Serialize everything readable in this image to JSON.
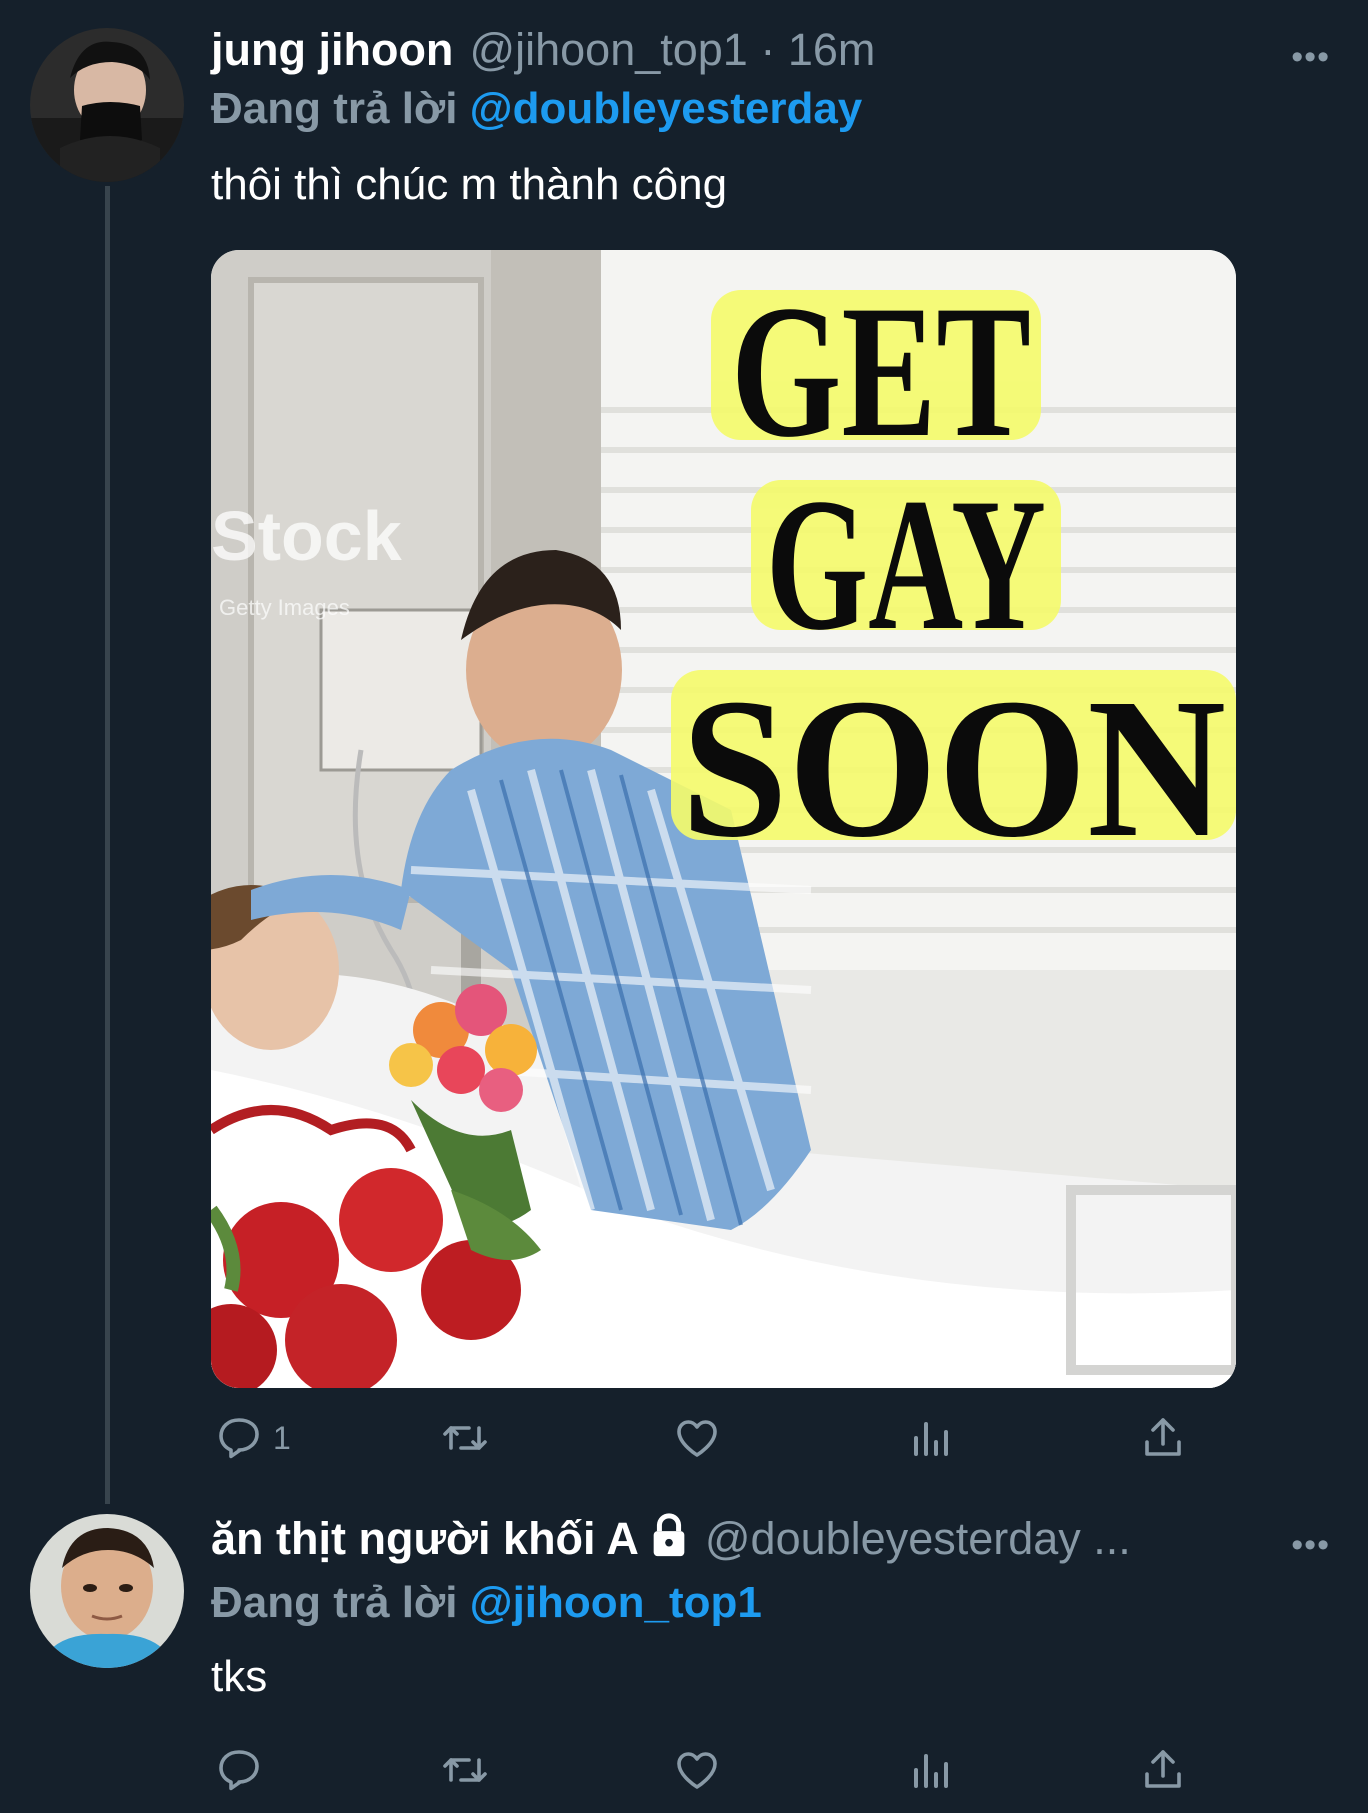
{
  "tweets": [
    {
      "name": "jung jihoon",
      "handle": "@jihoon_top1 · 16m",
      "reply_prefix": "Đang trả lời",
      "reply_mention": "@doubleyesterday",
      "text": "thôi thì chúc m thành công",
      "more": "•••",
      "reply_count": "1",
      "image": {
        "headline_1": "GET",
        "headline_2": "GAY",
        "headline_3": "SOON",
        "watermark": "Stock",
        "watermark_sub": "Getty Images"
      }
    },
    {
      "name": "ăn thịt người khối A",
      "handle": "@doubleyesterday ...",
      "reply_prefix": "Đang trả lời",
      "reply_mention": "@jihoon_top1",
      "text": "tks",
      "more": "•••",
      "locked": true,
      "reply_count": ""
    }
  ],
  "colors": {
    "background": "#15202b",
    "muted": "#8899a6",
    "accent": "#1d9bf0",
    "headline_highlight": "#f5fb6a"
  },
  "icons": [
    "reply-icon",
    "retweet-icon",
    "like-icon",
    "analytics-icon",
    "share-icon",
    "lock-icon",
    "more-icon"
  ]
}
